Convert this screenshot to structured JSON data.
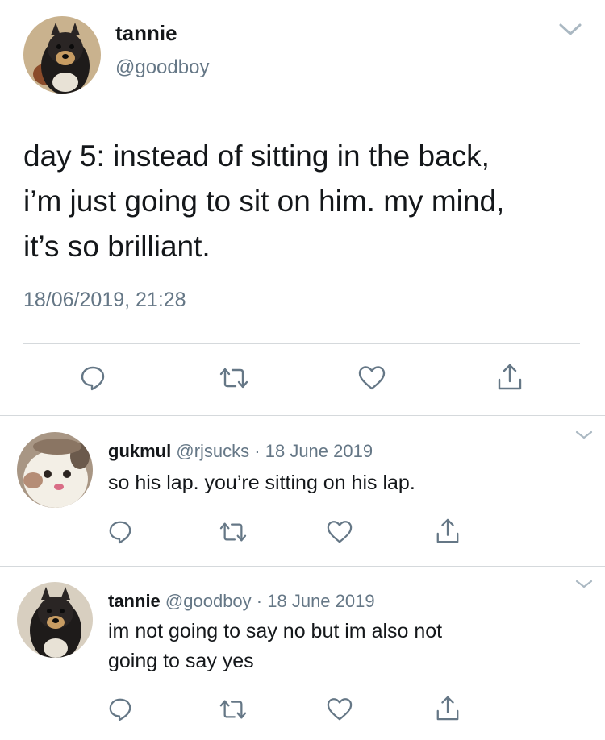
{
  "main_tweet": {
    "display_name": "tannie",
    "handle": "@goodboy",
    "text_lines": [
      "day 5: instead of sitting in the back,",
      "i’m just going to sit on him. my mind,",
      "it’s so brilliant."
    ],
    "timestamp": "18/06/2019, 21:28",
    "actions": [
      "reply-icon",
      "retweet-icon",
      "like-icon",
      "share-icon"
    ]
  },
  "replies": [
    {
      "display_name": "gukmul",
      "handle": "@rjsucks",
      "separator": "·",
      "date": "18 June 2019",
      "text_lines": [
        "so his lap. you’re sitting on his lap."
      ],
      "actions": [
        "reply-icon",
        "retweet-icon",
        "like-icon",
        "share-icon"
      ]
    },
    {
      "display_name": "tannie",
      "handle": "@goodboy",
      "separator": "·",
      "date": "18 June 2019",
      "text_lines": [
        "im not going to say no but im also not",
        "going to say yes"
      ],
      "actions": [
        "reply-icon",
        "retweet-icon",
        "like-icon",
        "share-icon"
      ]
    }
  ],
  "colors": {
    "text": "#14171a",
    "muted": "#657786",
    "divider": "#d5d9dc",
    "icon": "#657786"
  }
}
